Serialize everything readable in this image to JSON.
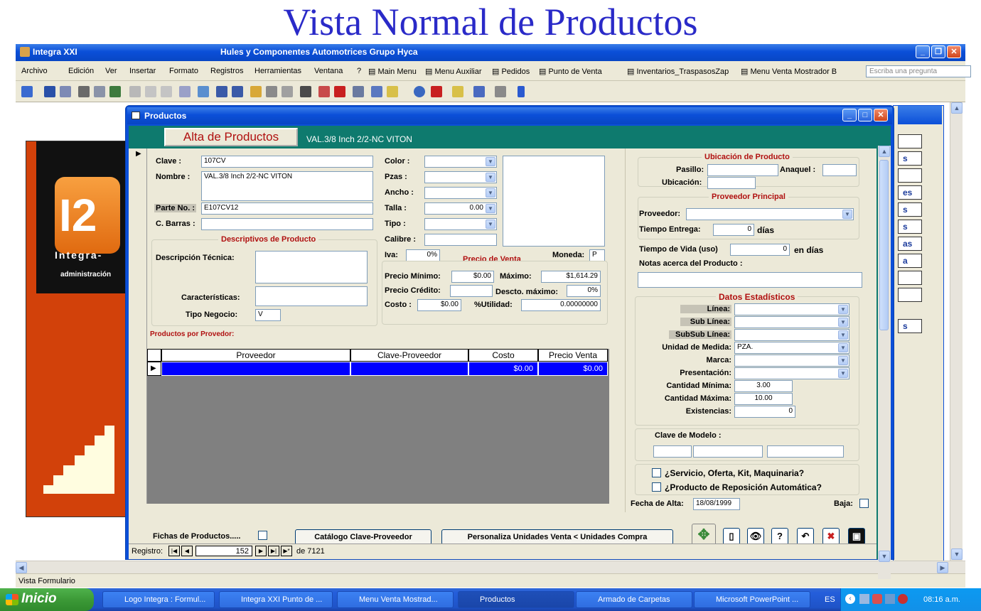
{
  "slide_title": "Vista Normal de Productos",
  "app": {
    "title": "Integra XXI",
    "company": "Hules y Componentes Automotrices Grupo Hyca"
  },
  "menu": [
    "Archivo",
    "Edición",
    "Ver",
    "Insertar",
    "Formato",
    "Registros",
    "Herramientas",
    "Ventana",
    "?"
  ],
  "menu_shortcuts": [
    "Main Menu",
    "Menu Auxiliar",
    "Pedidos",
    "Punto de Venta",
    "Inventarios_TraspasosZap",
    "Menu Venta Mostrador B"
  ],
  "ask_placeholder": "Escriba una pregunta",
  "logo": {
    "letters": "I2",
    "brand": "Integra-",
    "tagline": "administración"
  },
  "bg_form_letters": [
    "s",
    "es",
    "s",
    "s",
    "as",
    "a",
    "s"
  ],
  "window": {
    "title": "Productos"
  },
  "form": {
    "alta_button": "Alta de Productos",
    "header_product": "VAL.3/8  Inch  2/2-NC VITON",
    "clave_label": "Clave :",
    "clave": "107CV",
    "nombre_label": "Nombre :",
    "nombre": "VAL.3/8  Inch  2/2-NC VITON",
    "parte_label": "Parte No. :",
    "parte": "E107CV12",
    "barras_label": "C. Barras :",
    "descriptivos_title": "Descriptivos de Producto",
    "desc_tecnica_label": "Descripción Técnica:",
    "caracteristicas_label": "Características:",
    "tipo_negocio_label": "Tipo Negocio:",
    "tipo_negocio": "V",
    "color_label": "Color :",
    "pzas_label": "Pzas :",
    "ancho_label": "Ancho :",
    "talla_label": "Talla :",
    "talla": "0.00",
    "tipo_label": "Tipo :",
    "calibre_label": "Calibre :",
    "iva_label": "Iva:",
    "iva": "0%",
    "precio_venta_title": "Precio de Venta",
    "moneda_label": "Moneda:",
    "moneda": "P",
    "precio_minimo_label": "Precio Mínimo:",
    "precio_minimo": "$0.00",
    "maximo_label": "Máximo:",
    "maximo": "$1,614.29",
    "precio_credito_label": "Precio Crédito:",
    "descto_label": "Descto. máximo:",
    "descto": "0%",
    "costo_label": "Costo :",
    "costo": "$0.00",
    "utilidad_label": "%Utilidad:",
    "utilidad": "0.00000000",
    "productos_proveedor_label": "Productos por Provedor:",
    "grid_headers": [
      "Proveedor",
      "Clave-Proveedor",
      "Costo",
      "Precio Venta"
    ],
    "grid_row": {
      "costo": "$0.00",
      "precio": "$0.00"
    },
    "ubicacion_title": "Ubicación de Producto",
    "pasillo_label": "Pasillo:",
    "anaquel_label": "Anaquel :",
    "ubicacion_label": "Ubicación:",
    "proveedor_principal_title": "Proveedor Principal",
    "proveedor_label": "Proveedor:",
    "tiempo_entrega_label": "Tiempo Entrega:",
    "tiempo_entrega": "0",
    "dias": "días",
    "tiempo_vida_label": "Tiempo de Vida (uso)",
    "tiempo_vida": "0",
    "en_dias": "en días",
    "notas_label": "Notas acerca del Producto :",
    "datos_title": "Datos Estadísticos",
    "linea_label": "Línea:",
    "sublinea_label": "Sub Línea:",
    "subsublinea_label": "SubSub Línea:",
    "unidad_label": "Unidad de Medida:",
    "unidad": "PZA.",
    "marca_label": "Marca:",
    "presentacion_label": "Presentación:",
    "cant_min_label": "Cantidad Mínima:",
    "cant_min": "3.00",
    "cant_max_label": "Cantidad Máxima:",
    "cant_max": "10.00",
    "existencias_label": "Existencias:",
    "existencias": "0",
    "clave_modelo_label": "Clave de Modelo :",
    "servicio_label": "¿Servicio, Oferta, Kit, Maquinaria?",
    "reposicion_label": "¿Producto de Reposición Automática?",
    "fecha_alta_label": "Fecha de Alta:",
    "fecha_alta": "18/08/1999",
    "baja_label": "Baja:",
    "fichas_label": "Fichas de Productos.....",
    "catalogo_button": "Catálogo Clave-Proveedor",
    "personaliza_button": "Personaliza Unidades Venta < Unidades Compra",
    "registro_label": "Registro:",
    "registro": "152",
    "de_total": "de  7121"
  },
  "status_text": "Vista Formulario",
  "taskbar": {
    "start": "Inicio",
    "tasks": [
      "Logo Integra : Formul...",
      "Integra XXI Punto de ...",
      "Menu Venta Mostrad...",
      "Productos",
      "Armado de Carpetas",
      "Microsoft PowerPoint ..."
    ],
    "lang": "ES",
    "time": "08:16 a.m."
  },
  "colors": {
    "form_teal": "#0e7a6e",
    "xp_blue": "#0b4fd8",
    "grid_row": "#0000ff",
    "label_red": "#b01010"
  }
}
